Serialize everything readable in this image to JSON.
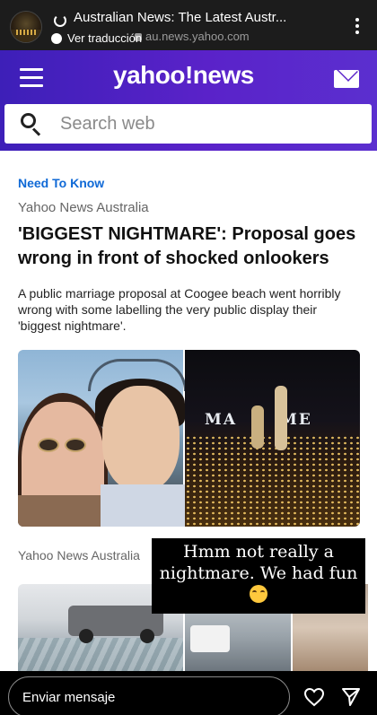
{
  "story": {
    "page_title": "Australian News: The Latest Austr...",
    "url": "au.news.yahoo.com",
    "translate_label": "Ver traducción",
    "menu_icon": "more-vertical-icon"
  },
  "header": {
    "logo": "yahoo!news",
    "menu_icon": "hamburger-menu-icon",
    "mail_icon": "mail-icon",
    "search_placeholder": "Search web"
  },
  "article": {
    "section": "Need To Know",
    "source": "Yahoo News Australia",
    "headline": "'BIGGEST NIGHTMARE': Proposal goes wrong in front of shocked onlookers",
    "summary": "A public marriage proposal at Coogee beach went horribly wrong with some labelling the very public display their 'biggest nightmare'.",
    "image_sign_left": "MA",
    "image_sign_right": "ME"
  },
  "next_article": {
    "source": "Yahoo News Australia"
  },
  "caption": {
    "line1": "Hmm not really a",
    "line2": "nightmare. We had fun",
    "emoji_icon": "laughing-emoji-icon"
  },
  "reply": {
    "placeholder": "Enviar mensaje",
    "like_icon": "heart-icon",
    "send_icon": "send-icon"
  },
  "colors": {
    "header_gradient_start": "#3d1fb8",
    "header_gradient_end": "#5b2fcf",
    "section_blue": "#0f69d6"
  }
}
